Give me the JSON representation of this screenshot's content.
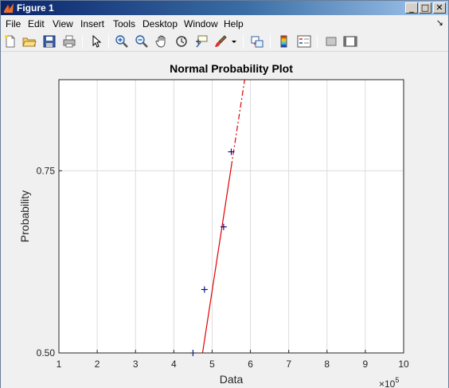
{
  "window": {
    "title": "Figure 1",
    "controls": [
      "_",
      "□",
      "✕"
    ]
  },
  "menu": {
    "items": [
      "File",
      "Edit",
      "View",
      "Insert",
      "Tools",
      "Desktop",
      "Window",
      "Help"
    ],
    "dock_arrow": "↘"
  },
  "toolbar": {
    "icons": [
      "new-figure-icon",
      "open-file-icon",
      "save-icon",
      "print-icon",
      "edit-plot-arrow-icon",
      "zoom-in-icon",
      "zoom-out-icon",
      "pan-hand-icon",
      "rotate-3d-icon",
      "data-cursor-icon",
      "brush-icon",
      "brush-dropdown-icon",
      "link-plot-icon",
      "insert-colorbar-icon",
      "insert-legend-icon",
      "hide-plot-tools-icon",
      "show-plot-tools-icon"
    ]
  },
  "chart_data": {
    "type": "scatter",
    "title": "Normal Probability Plot",
    "xlabel": "Data",
    "ylabel": "Probability",
    "x_exponent_label": "×10",
    "x_exponent_power": "5",
    "xlim": [
      1,
      10
    ],
    "ylim": [
      0.5,
      0.875
    ],
    "x_ticks": [
      "1",
      "2",
      "3",
      "4",
      "5",
      "6",
      "7",
      "8",
      "9",
      "10"
    ],
    "y_ticks": [
      {
        "value": 0.5,
        "label": "0.50"
      },
      {
        "value": 0.75,
        "label": "0.75"
      }
    ],
    "grid": true,
    "points": [
      {
        "x": 4.5,
        "y": 0.5
      },
      {
        "x": 4.8,
        "y": 0.587
      },
      {
        "x": 5.3,
        "y": 0.673
      },
      {
        "x": 5.5,
        "y": 0.776
      }
    ],
    "fit_line": {
      "x1": 4.75,
      "y1": 0.5,
      "x2": 5.85,
      "y2": 0.875,
      "solid_until_x": 5.5
    },
    "colors": {
      "points": "#00008b",
      "fit": "#e00000",
      "grid": "#dcdcdc",
      "axes_bg": "#ffffff"
    }
  }
}
